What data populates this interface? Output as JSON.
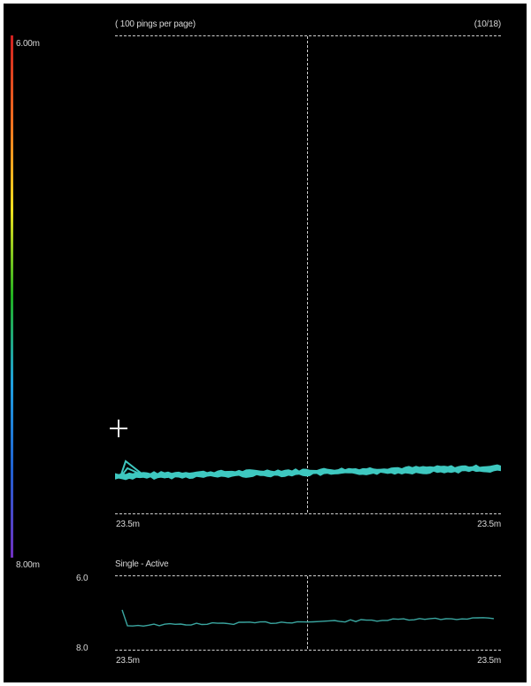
{
  "header": {
    "pings_label": "( 100 pings per page)",
    "page_counter": "(10/18)"
  },
  "colorbar": {
    "top_label": "6.00m",
    "bottom_label": "8.00m",
    "colors": [
      "#d02020",
      "#f07020",
      "#f0e020",
      "#20b020",
      "#20a0e0",
      "#2060d0",
      "#7030c0"
    ]
  },
  "main_plot": {
    "range_left": "23.5m",
    "range_right": "23.5m",
    "trace_color": "#3ec8c0"
  },
  "profile_plot": {
    "mode_label": "Single - Active",
    "axis_top": "6.0",
    "axis_bottom": "8.0",
    "range_left": "23.5m",
    "range_right": "23.5m",
    "trace_color": "#3aa6a0"
  },
  "icons": {
    "cursor": "crosshair-cursor-icon"
  }
}
